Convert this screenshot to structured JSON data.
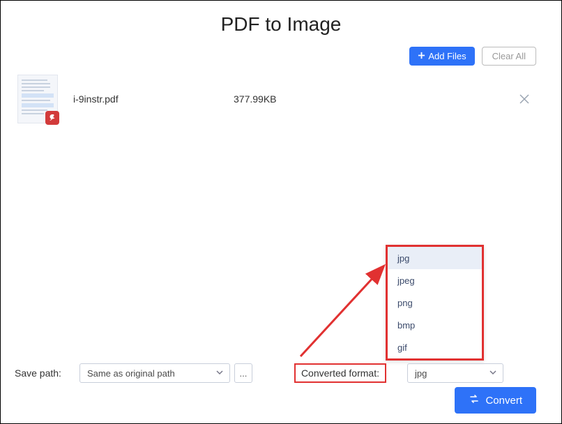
{
  "header": {
    "title": "PDF to Image"
  },
  "toolbar": {
    "add_label": "Add Files",
    "clear_label": "Clear All"
  },
  "files": [
    {
      "name": "i-9instr.pdf",
      "size": "377.99KB"
    }
  ],
  "bottom": {
    "save_path_label": "Save path:",
    "save_path_value": "Same as original path",
    "browse_label": "...",
    "converted_format_label": "Converted format:",
    "format_value": "jpg"
  },
  "format_options": [
    "jpg",
    "jpeg",
    "png",
    "bmp",
    "gif"
  ],
  "actions": {
    "convert_label": "Convert"
  }
}
